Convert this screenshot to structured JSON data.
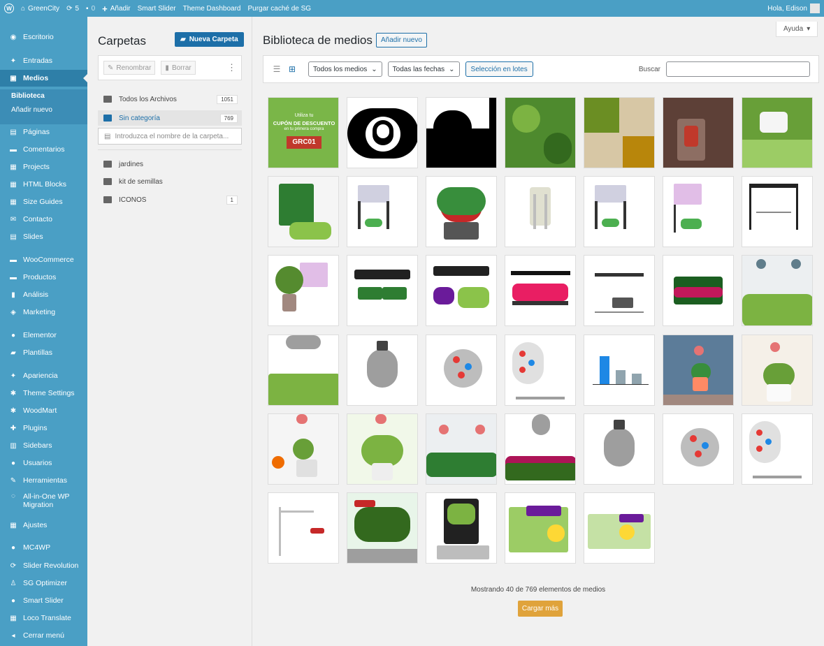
{
  "adminbar": {
    "site_name": "GreenCity",
    "updates_count": "5",
    "comments_count": "0",
    "add_label": "Añadir",
    "links": [
      "Smart Slider",
      "Theme Dashboard",
      "Purgar caché de SG"
    ],
    "greeting": "Hola, Edison"
  },
  "sidebar": {
    "items": [
      {
        "label": "Escritorio",
        "icon": "dashboard-icon"
      },
      {
        "label": "Entradas",
        "icon": "pin-icon"
      },
      {
        "label": "Medios",
        "icon": "media-icon"
      },
      {
        "label": "Páginas",
        "icon": "pages-icon"
      },
      {
        "label": "Comentarios",
        "icon": "comments-icon"
      },
      {
        "label": "Projects",
        "icon": "projects-icon"
      },
      {
        "label": "HTML Blocks",
        "icon": "html-blocks-icon"
      },
      {
        "label": "Size Guides",
        "icon": "size-guides-icon"
      },
      {
        "label": "Contacto",
        "icon": "mail-icon"
      },
      {
        "label": "Slides",
        "icon": "slides-icon"
      },
      {
        "label": "WooCommerce",
        "icon": "woocommerce-icon"
      },
      {
        "label": "Productos",
        "icon": "products-icon"
      },
      {
        "label": "Análisis",
        "icon": "analytics-icon"
      },
      {
        "label": "Marketing",
        "icon": "marketing-icon"
      },
      {
        "label": "Elementor",
        "icon": "elementor-icon"
      },
      {
        "label": "Plantillas",
        "icon": "folder-icon"
      },
      {
        "label": "Apariencia",
        "icon": "appearance-icon"
      },
      {
        "label": "Theme Settings",
        "icon": "theme-settings-icon"
      },
      {
        "label": "WoodMart",
        "icon": "woodmart-icon"
      },
      {
        "label": "Plugins",
        "icon": "plugins-icon"
      },
      {
        "label": "Sidebars",
        "icon": "sidebars-icon"
      },
      {
        "label": "Usuarios",
        "icon": "users-icon"
      },
      {
        "label": "Herramientas",
        "icon": "tools-icon"
      },
      {
        "label": "All-in-One WP Migration",
        "icon": "migration-icon"
      },
      {
        "label": "Ajustes",
        "icon": "settings-icon"
      },
      {
        "label": "MC4WP",
        "icon": "mc4wp-icon"
      },
      {
        "label": "Slider Revolution",
        "icon": "slider-revolution-icon"
      },
      {
        "label": "SG Optimizer",
        "icon": "sg-optimizer-icon"
      },
      {
        "label": "Smart Slider",
        "icon": "smart-slider-icon"
      },
      {
        "label": "Loco Translate",
        "icon": "translate-icon"
      },
      {
        "label": "Cerrar menú",
        "icon": "collapse-icon"
      }
    ],
    "submenu": [
      "Biblioteca",
      "Añadir nuevo"
    ]
  },
  "folders": {
    "title": "Carpetas",
    "new_folder_label": "Nueva Carpeta",
    "rename_label": "Renombrar",
    "delete_label": "Borrar",
    "all_files_label": "Todos los Archivos",
    "all_files_count": "1051",
    "uncategorized_label": "Sin categoría",
    "uncategorized_count": "769",
    "search_placeholder": "Introduzca el nombre de la carpeta...",
    "list": [
      {
        "name": "jardines",
        "count": ""
      },
      {
        "name": "kit de semillas",
        "count": ""
      },
      {
        "name": "ICONOS",
        "count": "1"
      }
    ]
  },
  "main": {
    "title": "Biblioteca de medios",
    "add_new_label": "Añadir nuevo",
    "help_label": "Ayuda",
    "filter_media": "Todos los medios",
    "filter_dates": "Todas las fechas",
    "bulk_select_label": "Selección en lotes",
    "search_label": "Buscar",
    "coupon": {
      "line1": "Utiliza tu",
      "line2": "CUPÓN DE DESCUENTO",
      "line3": "en tu primera compra",
      "code": "GRC01"
    },
    "status_text": "Mostrando 40 de 769 elementos de medios",
    "load_more_label": "Cargar más"
  },
  "colors": {
    "admin_blue": "#4a9fc5",
    "primary": "#1d6fa8",
    "load_more": "#e0a33b"
  }
}
